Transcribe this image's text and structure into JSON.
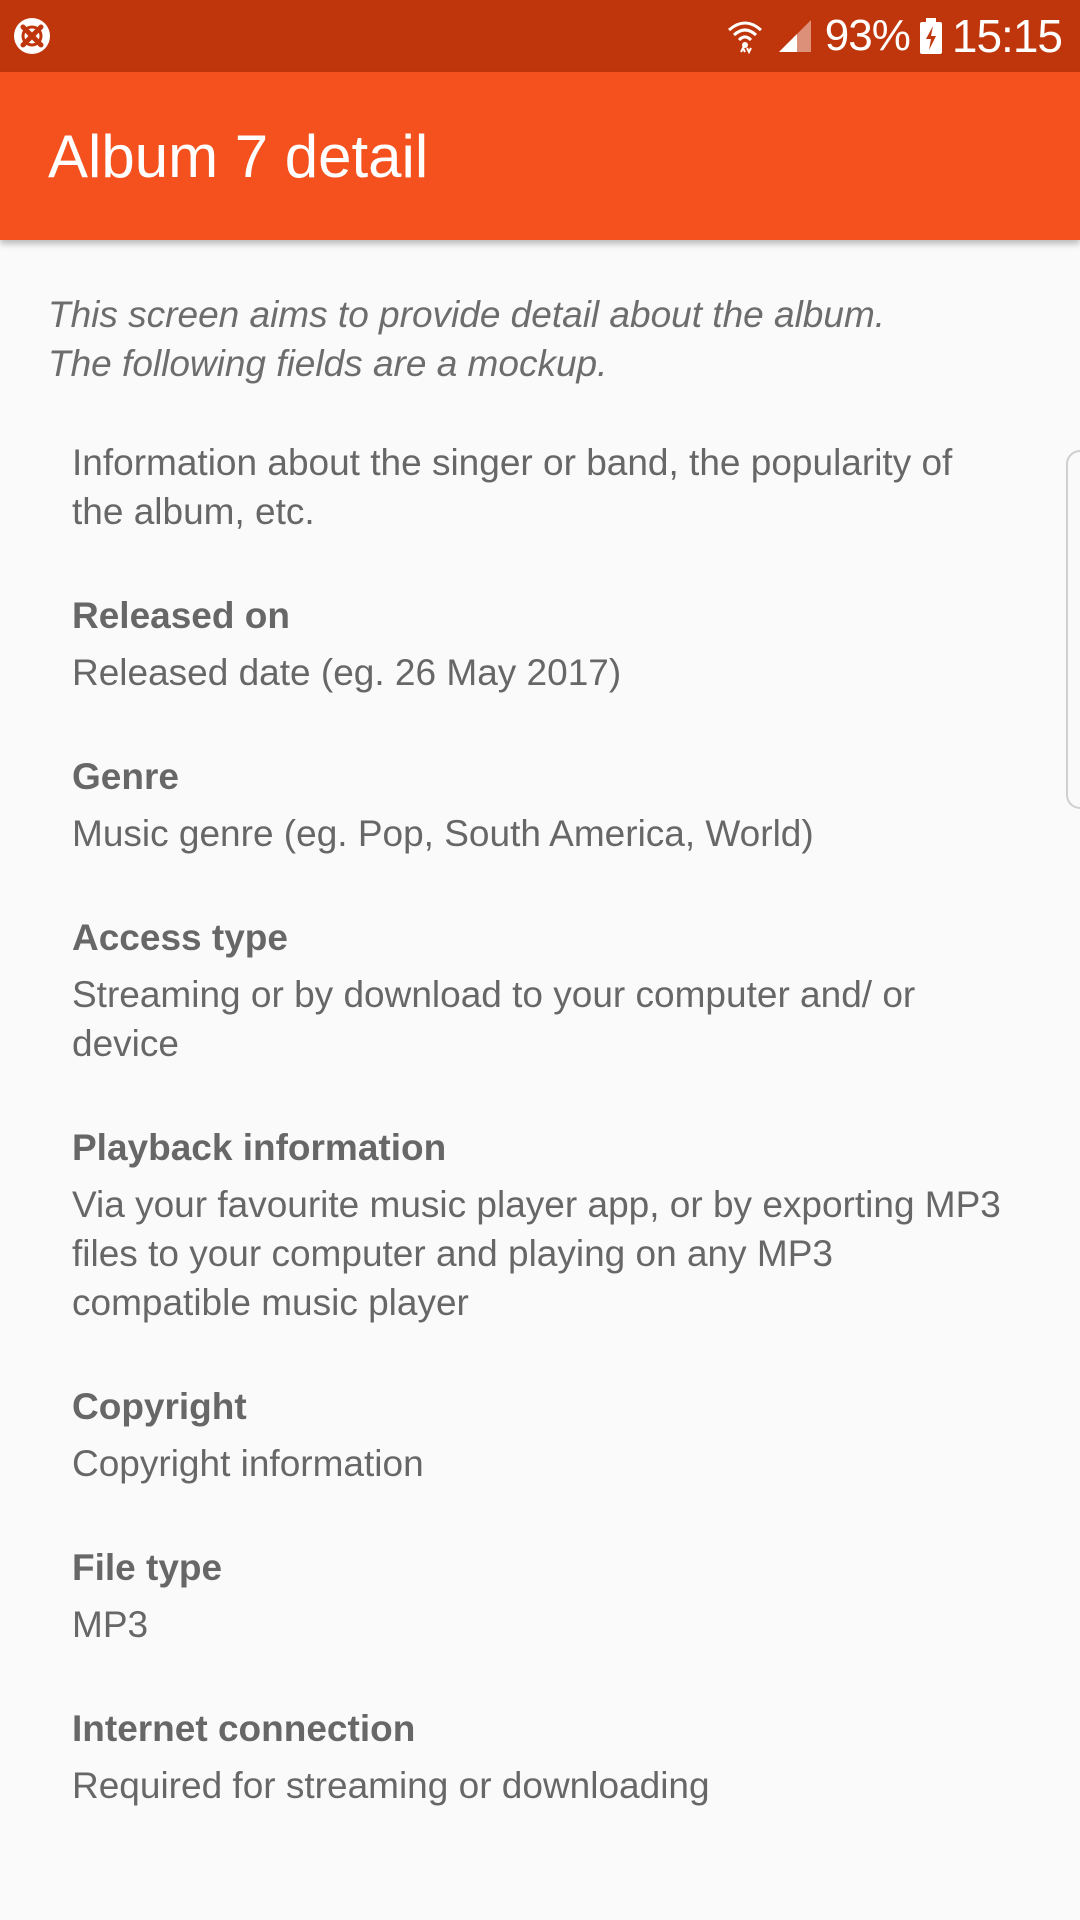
{
  "status_bar": {
    "left_icon": "no-sync-icon",
    "wifi_icon": "wifi-icon",
    "signal_icon": "signal-icon",
    "battery_percent": "93%",
    "battery_icon": "battery-charging-icon",
    "time": "15:15"
  },
  "app_bar": {
    "title": "Album 7 detail",
    "color": "#f4511e",
    "status_color": "#bf360c"
  },
  "content": {
    "intro": "This screen aims to provide detail about the album.\nThe following fields are a mockup.",
    "about": "Information about the singer or band, the popularity of the album, etc.",
    "fields": [
      {
        "label": "Released on",
        "value": "Released date (eg. 26 May 2017)"
      },
      {
        "label": "Genre",
        "value": "Music genre (eg. Pop, South America, World)"
      },
      {
        "label": "Access type",
        "value": "Streaming or by download to your computer and/ or device"
      },
      {
        "label": "Playback information",
        "value": "Via your favourite music player app, or by exporting MP3 files to your computer and playing on any MP3 compatible music player"
      },
      {
        "label": "Copyright",
        "value": "Copyright information"
      },
      {
        "label": "File type",
        "value": "MP3"
      },
      {
        "label": "Internet connection",
        "value": "Required for streaming or downloading"
      }
    ]
  }
}
